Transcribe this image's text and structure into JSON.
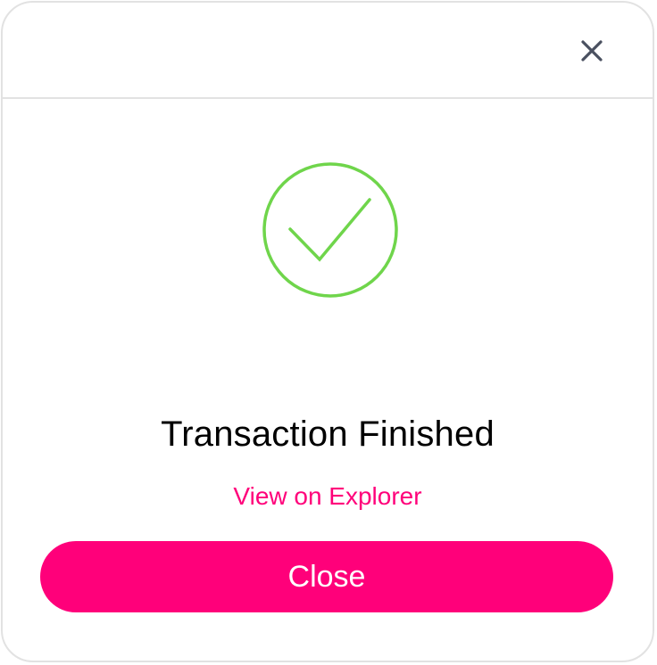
{
  "modal": {
    "close_icon": "close-icon",
    "status_icon": "checkmark-circle-icon",
    "title": "Transaction Finished",
    "explorer_link": "View on Explorer",
    "close_button": "Close"
  },
  "colors": {
    "accent": "#ff007a",
    "success": "#6fd54b",
    "border": "#e2e2e2",
    "icon_gray": "#4a5060"
  }
}
